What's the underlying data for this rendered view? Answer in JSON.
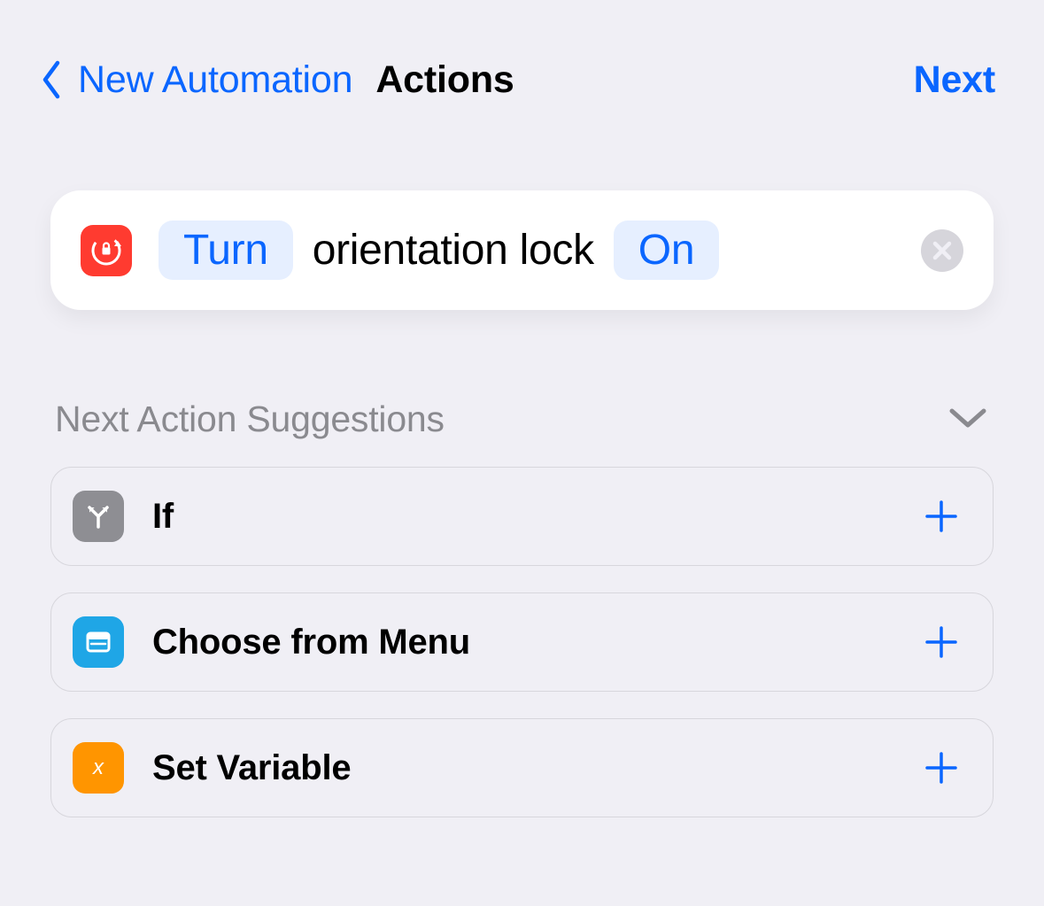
{
  "nav": {
    "back_label": "New Automation",
    "title": "Actions",
    "next_label": "Next"
  },
  "action": {
    "icon": "orientation-lock-icon",
    "verb": "Turn",
    "target": "orientation lock",
    "state": "On"
  },
  "suggestions": {
    "header": "Next Action Suggestions",
    "items": [
      {
        "label": "If",
        "icon": "branch-icon",
        "icon_color": "grey"
      },
      {
        "label": "Choose from Menu",
        "icon": "menu-icon",
        "icon_color": "blue"
      },
      {
        "label": "Set Variable",
        "icon": "variable-icon",
        "icon_color": "orange"
      }
    ]
  },
  "colors": {
    "accent": "#0a66ff",
    "danger": "#ff3b30",
    "background": "#f0eff5"
  }
}
